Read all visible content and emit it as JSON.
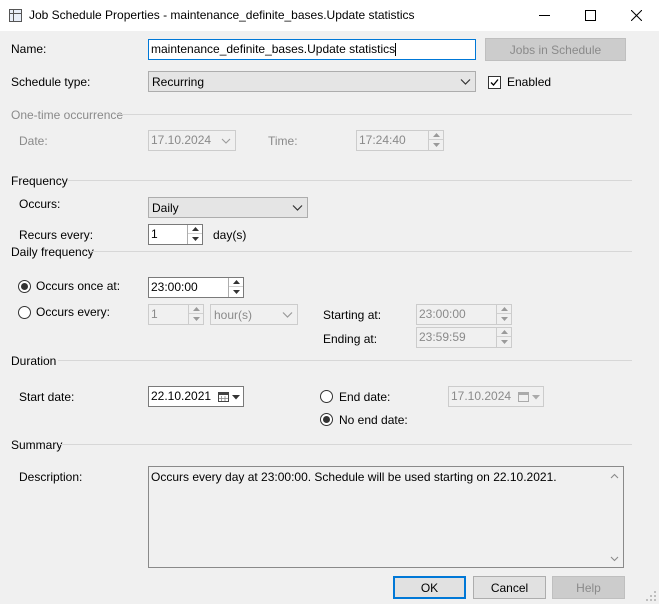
{
  "window": {
    "title": "Job Schedule Properties - maintenance_definite_bases.Update statistics"
  },
  "name": {
    "label": "Name:",
    "value": "maintenance_definite_bases.Update statistics",
    "jobs_button": "Jobs in Schedule"
  },
  "schedule_type": {
    "label": "Schedule type:",
    "value": "Recurring",
    "enabled_label": "Enabled",
    "enabled_checked": true
  },
  "one_time": {
    "header": "One-time occurrence",
    "date_label": "Date:",
    "date_value": "17.10.2024",
    "time_label": "Time:",
    "time_value": "17:24:40"
  },
  "frequency": {
    "header": "Frequency",
    "occurs_label": "Occurs:",
    "occurs_value": "Daily",
    "recurs_label": "Recurs every:",
    "recurs_value": "1",
    "recurs_unit": "day(s)"
  },
  "daily_frequency": {
    "header": "Daily frequency",
    "once_label": "Occurs once at:",
    "once_value": "23:00:00",
    "every_label": "Occurs every:",
    "every_value": "1",
    "every_unit": "hour(s)",
    "starting_label": "Starting at:",
    "starting_value": "23:00:00",
    "ending_label": "Ending at:",
    "ending_value": "23:59:59"
  },
  "duration": {
    "header": "Duration",
    "start_label": "Start date:",
    "start_value": "22.10.2021",
    "end_label": "End date:",
    "end_value": "17.10.2024",
    "no_end_label": "No end date:"
  },
  "summary": {
    "header": "Summary",
    "description_label": "Description:",
    "description_value": "Occurs every day at 23:00:00. Schedule will be used starting on 22.10.2021."
  },
  "buttons": {
    "ok": "OK",
    "cancel": "Cancel",
    "help": "Help"
  },
  "colors": {
    "accent": "#0078d7",
    "background": "#f0f0f0"
  }
}
